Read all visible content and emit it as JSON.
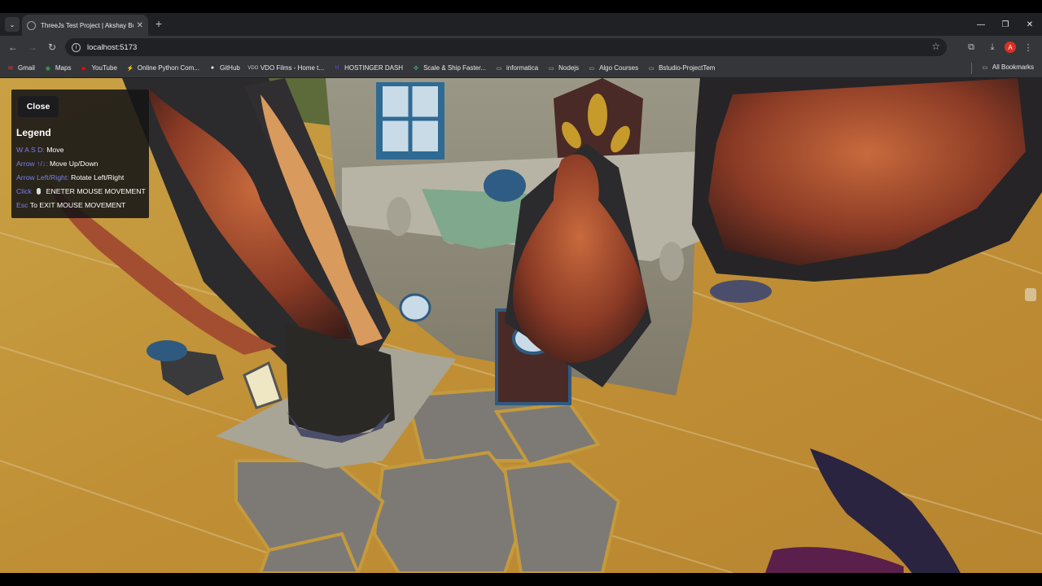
{
  "browser": {
    "tab": {
      "title": "ThreeJs Test Project | Akshay Bo"
    },
    "address_bar": {
      "url": "localhost:5173"
    },
    "profile_initial": "A",
    "bookmarks": [
      {
        "label": "Gmail",
        "icon": "gmail-icon",
        "color": "#ea4335"
      },
      {
        "label": "Maps",
        "icon": "maps-icon",
        "color": "#34a853"
      },
      {
        "label": "YouTube",
        "icon": "youtube-icon",
        "color": "#ff0000"
      },
      {
        "label": "Online Python Com...",
        "icon": "python-icon",
        "color": "#4285f4"
      },
      {
        "label": "GitHub",
        "icon": "github-icon",
        "color": "#ffffff"
      },
      {
        "label": "VDO Films - Home t...",
        "icon": "vdo-icon",
        "color": "#cccccc"
      },
      {
        "label": "HOSTINGER DASH",
        "icon": "hostinger-icon",
        "color": "#673de6"
      },
      {
        "label": "Scale & Ship Faster...",
        "icon": "scale-icon",
        "color": "#3ecf8e"
      },
      {
        "label": "informatica",
        "icon": "folder-icon",
        "color": "#bdc1c6"
      },
      {
        "label": "Nodejs",
        "icon": "folder-icon",
        "color": "#bdc1c6"
      },
      {
        "label": "Algo Courses",
        "icon": "folder-icon",
        "color": "#bdc1c6"
      },
      {
        "label": "Bstudio-ProjectTem",
        "icon": "folder-icon",
        "color": "#bdc1c6"
      }
    ],
    "all_bookmarks_label": "All Bookmarks"
  },
  "legend": {
    "close_label": "Close",
    "title": "Legend",
    "rows": [
      {
        "key": "W A S D:",
        "value": "Move"
      },
      {
        "key": "Arrow ↑/↓:",
        "value": "Move Up/Down"
      },
      {
        "key": "Arrow Left/Right:",
        "value": "Rotate Left/Right"
      },
      {
        "key": "Click",
        "value": "ENETER MOUSE MOVEMENT"
      },
      {
        "key": "Esc",
        "value": "To EXIT MOUSE MOVEMENT"
      }
    ]
  },
  "colors": {
    "legend_key": "#7b7ff0",
    "chrome_dark": "#202124",
    "chrome_mid": "#35363a",
    "wood_floor": "#c79a3b"
  }
}
